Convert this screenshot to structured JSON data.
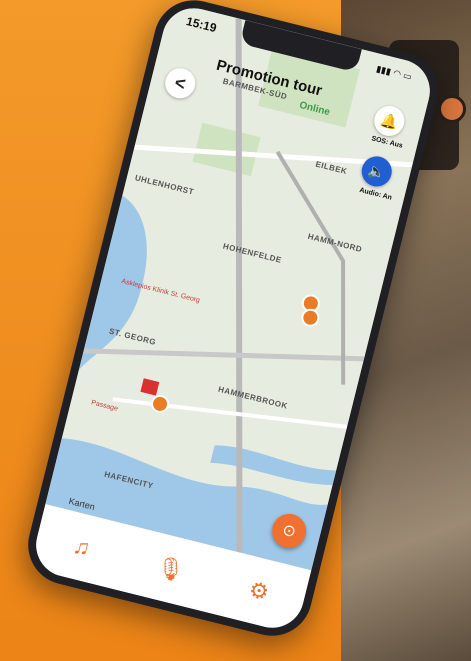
{
  "status": {
    "time": "15:19"
  },
  "header": {
    "title": "Promotion tour",
    "back_symbol": "<"
  },
  "controls": {
    "sos_label": "SOS: Aus",
    "audio_label": "Audio: An"
  },
  "map": {
    "online_label": "Online",
    "districts": [
      "BARMBEK-SÜD",
      "EILBEK",
      "HAMM-NORD",
      "HOHENFELDE",
      "ST. GEORG",
      "HAMMERBROOK",
      "HAFENCITY",
      "UHLENHORST"
    ],
    "pois": [
      "Asklepios Klinik St. Georg",
      "Passage"
    ],
    "attribution": "Karten"
  },
  "tabs": [
    {
      "name": "music"
    },
    {
      "name": "microphone"
    },
    {
      "name": "settings"
    }
  ],
  "colors": {
    "accent": "#f07032",
    "audio": "#1f5fd1",
    "background": "#f08a1c"
  }
}
